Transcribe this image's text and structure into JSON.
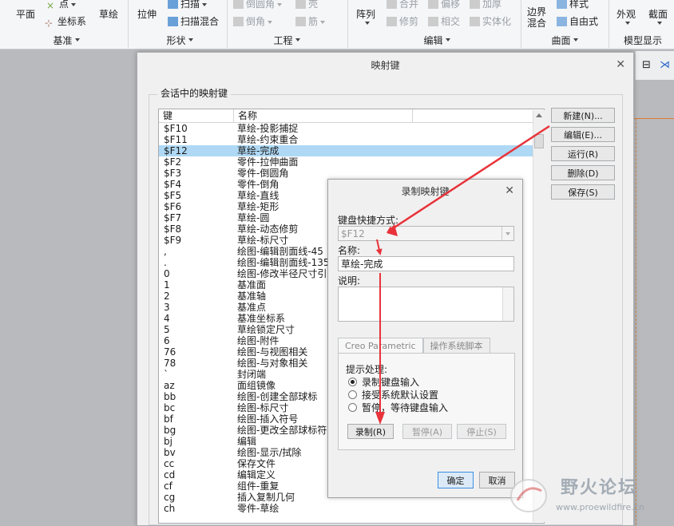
{
  "ribbon": {
    "buttons": {
      "plane": "平面",
      "point": "点",
      "csys": "坐标系",
      "sketch": "草绘",
      "extrude": "拉伸",
      "sweep": "扫描",
      "swept_blend": "扫描混合",
      "round": "倒圆角",
      "chamfer": "倒角",
      "shell": "壳",
      "rib": "筋",
      "pattern": "阵列",
      "merge": "合并",
      "trim": "修剪",
      "offset": "偏移",
      "intersect": "相交",
      "thicken": "加厚",
      "solidify": "实体化",
      "boundary_blend_1": "边界",
      "boundary_blend_2": "混合",
      "style": "样式",
      "freestyle": "自由式",
      "appearance": "外观",
      "section": "截面"
    },
    "groups": {
      "datum": "基准",
      "shapes": "形状",
      "engineering": "工程",
      "editing": "编辑",
      "surfaces": "曲面",
      "model_display": "模型显示"
    }
  },
  "main_dialog": {
    "title": "映射键",
    "group_label": "会话中的映射键",
    "columns": [
      "键",
      "名称"
    ],
    "rows": [
      {
        "key": "$F10",
        "name": "草绘-投影捕捉"
      },
      {
        "key": "$F11",
        "name": "草绘-约束重合"
      },
      {
        "key": "$F12",
        "name": "草绘-完成"
      },
      {
        "key": "$F2",
        "name": "零件-拉伸曲面"
      },
      {
        "key": "$F3",
        "name": "零件-倒圆角"
      },
      {
        "key": "$F4",
        "name": "零件-倒角"
      },
      {
        "key": "$F5",
        "name": "草绘-直线"
      },
      {
        "key": "$F6",
        "name": "草绘-矩形"
      },
      {
        "key": "$F7",
        "name": "草绘-圆"
      },
      {
        "key": "$F8",
        "name": "草绘-动态修剪"
      },
      {
        "key": "$F9",
        "name": "草绘-标尺寸"
      },
      {
        "key": ",",
        "name": "绘图-编辑剖面线-45"
      },
      {
        "key": ".",
        "name": "绘图-编辑剖面线-135"
      },
      {
        "key": "0",
        "name": "绘图-修改半径尺寸引"
      },
      {
        "key": "1",
        "name": "基准面"
      },
      {
        "key": "2",
        "name": "基准轴"
      },
      {
        "key": "3",
        "name": "基准点"
      },
      {
        "key": "4",
        "name": "基准坐标系"
      },
      {
        "key": "5",
        "name": "草绘锁定尺寸"
      },
      {
        "key": "6",
        "name": "绘图-附件"
      },
      {
        "key": "76",
        "name": "绘图-与视图相关"
      },
      {
        "key": "78",
        "name": "绘图-与对象相关"
      },
      {
        "key": "`",
        "name": "封闭端"
      },
      {
        "key": "az",
        "name": "面组镜像"
      },
      {
        "key": "bb",
        "name": "绘图-创建全部球标"
      },
      {
        "key": "bc",
        "name": "绘图-标尺寸"
      },
      {
        "key": "bf",
        "name": "绘图-插入符号"
      },
      {
        "key": "bg",
        "name": "绘图-更改全部球标符"
      },
      {
        "key": "bj",
        "name": "编辑"
      },
      {
        "key": "bv",
        "name": "绘图-显示/拭除"
      },
      {
        "key": "cc",
        "name": "保存文件"
      },
      {
        "key": "cd",
        "name": "编辑定义"
      },
      {
        "key": "cf",
        "name": "组件-重复"
      },
      {
        "key": "cg",
        "name": "插入复制几何"
      },
      {
        "key": "ch",
        "name": "零件-草绘"
      }
    ],
    "selected_index": 2,
    "buttons": {
      "new": "新建(N)...",
      "edit": "编辑(E)...",
      "run": "运行(R)",
      "delete": "删除(D)",
      "save": "保存(S)"
    }
  },
  "record_dialog": {
    "title": "录制映射键",
    "shortcut_label": "键盘快捷方式:",
    "shortcut_value": "$F12",
    "name_label": "名称:",
    "name_value": "草绘-完成",
    "desc_label": "说明:",
    "desc_value": "",
    "tabs": [
      "Creo Parametric",
      "操作系统脚本"
    ],
    "prompt_label": "提示处理:",
    "options": [
      "录制键盘输入",
      "接受系统默认设置",
      "暂停，等待键盘输入"
    ],
    "selected_option": 0,
    "record_button": "录制(R)",
    "pause_button": "暂停(A)",
    "stop_button": "停止(S)",
    "ok_button": "确定",
    "cancel_button": "取消"
  },
  "watermark": {
    "title": "野火论坛",
    "url": "www.proewildfire.cn"
  },
  "colors": {
    "selection": "#aed8f4",
    "arrow": "#e8333a",
    "primary_button_border": "#3d8ee0"
  }
}
